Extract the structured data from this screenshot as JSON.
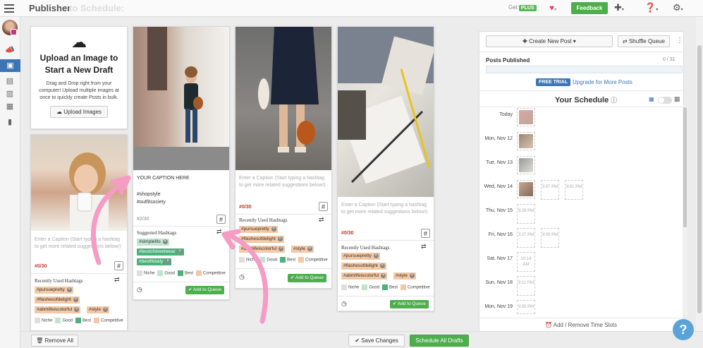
{
  "header": {
    "title": "Publisher",
    "ghost_text": "to Schedule:",
    "get_label": "Get",
    "plus_label": "PLUS",
    "feedback_label": "Feedback"
  },
  "upload_card": {
    "title": "Upload an Image to Start a New Draft",
    "description": "Drag and Drop right from your computer! Upload multiple images at once to quickly create Posts in bulk.",
    "button": "Upload Images"
  },
  "drafts": [
    {
      "caption_placeholder": "Enter a Caption (Start typing a hashtag to get more related suggestions below!)",
      "count": "#0/30",
      "hashtag_title": "Recently Used Hashtags",
      "tags": [
        {
          "label": "#pursuepretty",
          "kind": "comp"
        },
        {
          "label": "#flashesofdelight",
          "kind": "comp"
        },
        {
          "label": "#abmlifeiscolorful",
          "kind": "comp"
        },
        {
          "label": "#style",
          "kind": "comp"
        }
      ]
    },
    {
      "caption_lines": [
        "YOUR CAPTION HERE",
        "",
        "#shopstyle",
        "#outfitsociety"
      ],
      "count": "#2/30",
      "hashtag_title": "Suggested Hashtags",
      "tags": [
        {
          "label": "#simplefits",
          "kind": "good"
        },
        {
          "label": "#bestofstreetwear",
          "kind": "best"
        },
        {
          "label": "#bestfitdaily",
          "kind": "best"
        }
      ],
      "add_label": "Add to Queue"
    },
    {
      "caption_placeholder": "Enter a Caption (Start typing a hashtag to get more related suggestions below!)",
      "count": "#0/30",
      "hashtag_title": "Recently Used Hashtags",
      "tags": [
        {
          "label": "#pursuepretty",
          "kind": "comp"
        },
        {
          "label": "#flashesofdelight",
          "kind": "comp"
        },
        {
          "label": "#abmlifeiscolorful",
          "kind": "comp"
        },
        {
          "label": "#style",
          "kind": "comp"
        }
      ],
      "add_label": "Add to Queue"
    },
    {
      "caption_placeholder": "Enter a Caption (Start typing a hashtag to get more related suggestions below!)",
      "count": "#0/30",
      "hashtag_title": "Recently Used Hashtags",
      "tags": [
        {
          "label": "#pursuepretty",
          "kind": "comp"
        },
        {
          "label": "#flashesofdelight",
          "kind": "comp"
        },
        {
          "label": "#abmlifeiscolorful",
          "kind": "comp"
        },
        {
          "label": "#style",
          "kind": "comp"
        }
      ],
      "add_label": "Add to Queue"
    }
  ],
  "legend": {
    "niche": "Niche",
    "good": "Good",
    "best": "Best",
    "competitive": "Competitive"
  },
  "colors": {
    "niche": "#dedede",
    "good": "#bfe4cf",
    "best": "#4cb07a",
    "competitive": "#f4c8a4",
    "accent": "#4cae4c",
    "link": "#3b75b4"
  },
  "footer": {
    "remove_all": "Remove All",
    "save_changes": "Save Changes",
    "schedule_all": "Schedule All Drafts"
  },
  "schedule_panel": {
    "create_post": "Create New Post",
    "shuffle_queue": "Shuffle Queue",
    "posts_published_label": "Posts Published",
    "posts_published_value": "0 / 31",
    "free_trial": "FREE TRIAL",
    "upgrade_link": "Upgrade for More Posts",
    "schedule_title": "Your Schedule",
    "add_remove_slots": "Add / Remove Time Slots",
    "days": [
      {
        "label": "Today",
        "thumb": true,
        "slots": []
      },
      {
        "label": "Mon, Nov 12",
        "thumb": true,
        "slots": []
      },
      {
        "label": "Tue, Nov 13",
        "thumb": true,
        "slots": []
      },
      {
        "label": "Wed, Nov 14",
        "thumb": true,
        "slots": [
          "5:07 PM",
          "9:01 PM"
        ]
      },
      {
        "label": "Thu, Nov 15",
        "thumb": false,
        "slots": [
          "9:29 PM"
        ]
      },
      {
        "label": "Fri, Nov 16",
        "thumb": false,
        "slots": [
          "3:27 PM",
          "9:06 PM"
        ]
      },
      {
        "label": "Sat, Nov 17",
        "thumb": false,
        "slots": [
          "10:14 AM"
        ]
      },
      {
        "label": "Sun, Nov 18",
        "thumb": false,
        "slots": [
          "9:11 PM"
        ]
      },
      {
        "label": "Mon, Nov 19",
        "thumb": false,
        "slots": [
          "9:55 PM"
        ]
      }
    ]
  }
}
